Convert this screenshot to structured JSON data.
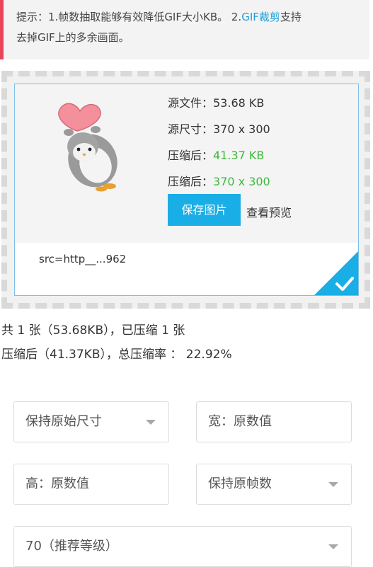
{
  "tip": {
    "prefix": "提示：1.帧数抽取能够有效降低GIF大小KB。 2.",
    "link": "GIF裁剪",
    "suffix": "支持",
    "line2": "去掉GIF上的多余画面。"
  },
  "card": {
    "source_size": "源文件：53.68 KB",
    "source_dims": "源尺寸：370 x 300",
    "compressed_label_1": "压缩后：",
    "compressed_size": "41.37 KB",
    "compressed_label_2": "压缩后：",
    "compressed_dims": "370 x 300",
    "save_button": "保存图片",
    "preview_link": "查看预览",
    "src_name": "src=http__...962"
  },
  "summary": {
    "line1": "共 1 张（53.68KB），已压缩 1 张",
    "line2": "压缩后（41.37KB），总压缩率 ： 22.92%"
  },
  "options": {
    "size_mode": "保持原始尺寸",
    "width": "宽：原数值",
    "height": "高：原数值",
    "frame_mode": "保持原帧数",
    "quality": "70（推荐等级）"
  },
  "colors": {
    "accent": "#1aaee6",
    "green": "#3cb93c",
    "tip_bar": "#e8445a",
    "link": "#1e9fd8"
  },
  "icons": {
    "thumbnail": "penguin-holding-heart-image",
    "selected": "check-icon"
  }
}
